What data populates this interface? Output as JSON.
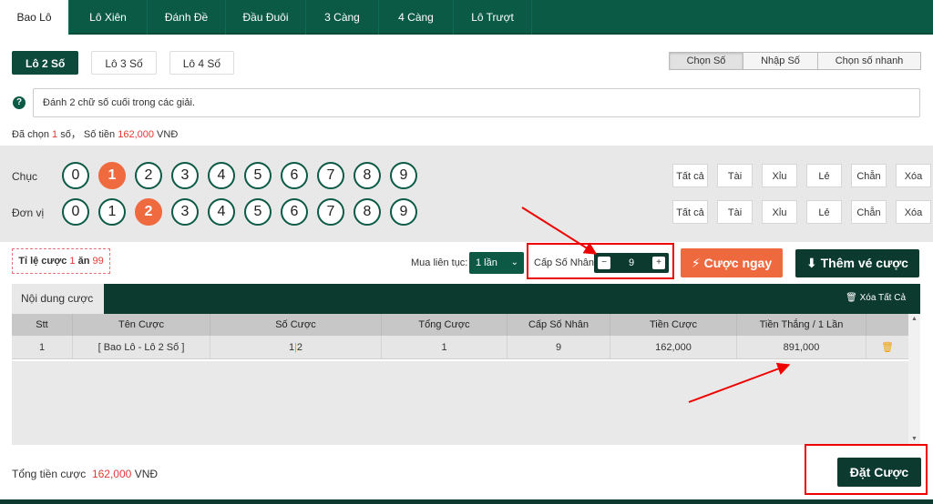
{
  "tabs": [
    "Bao Lô",
    "Lô Xiên",
    "Đánh Đề",
    "Đầu Đuôi",
    "3 Càng",
    "4 Càng",
    "Lô Trượt"
  ],
  "subtabs": [
    "Lô 2 Số",
    "Lô 3 Số",
    "Lô 4 Số"
  ],
  "modes": [
    "Chọn Số",
    "Nhập Số",
    "Chọn số nhanh"
  ],
  "help_icon": "question-circle-icon",
  "description": "Đánh 2 chữ số cuối trong các giải.",
  "summary": {
    "prefix": "Đã chọn",
    "count": "1",
    "unit": "số， Số tiền",
    "amount": "162,000",
    "currency": "VNĐ"
  },
  "picker": {
    "rows": [
      {
        "label": "Chục",
        "selected": 1
      },
      {
        "label": "Đơn vị",
        "selected": 2
      }
    ],
    "digits": [
      "0",
      "1",
      "2",
      "3",
      "4",
      "5",
      "6",
      "7",
      "8",
      "9"
    ],
    "quick": [
      "Tất cả",
      "Tài",
      "Xỉu",
      "Lẻ",
      "Chẵn",
      "Xóa"
    ]
  },
  "ratio": {
    "label": "Tỉ lệ cược",
    "a": "1",
    "mid": "ăn",
    "b": "99"
  },
  "consecutive": {
    "label": "Mua liên tục:",
    "value": "1 lần"
  },
  "multiplier": {
    "label": "Cấp Số Nhân",
    "value": "9",
    "minus": "−",
    "plus": "+"
  },
  "buttons": {
    "bet_now": "⚡ Cược ngay",
    "add_ticket": "⬇ Thêm vé cược",
    "place_bet": "Đặt Cược"
  },
  "content_tab": "Nội dung cược",
  "clear_all": "🗑 Xóa Tất Cả",
  "table": {
    "headers": [
      "Stt",
      "Tên Cược",
      "Số Cược",
      "Tổng Cược",
      "Cấp Số Nhân",
      "Tiền Cược",
      "Tiền Thắng / 1 Lần",
      ""
    ],
    "rows": [
      {
        "stt": "1",
        "name": "[ Bao Lô - Lô 2 Số ]",
        "num_a": "1",
        "num_b": "2",
        "total": "1",
        "mult": "9",
        "money": "162,000",
        "win": "891,000",
        "action": "🗑"
      }
    ]
  },
  "total": {
    "label": "Tổng tiền cược",
    "amount": "162,000",
    "currency": "VNĐ"
  }
}
